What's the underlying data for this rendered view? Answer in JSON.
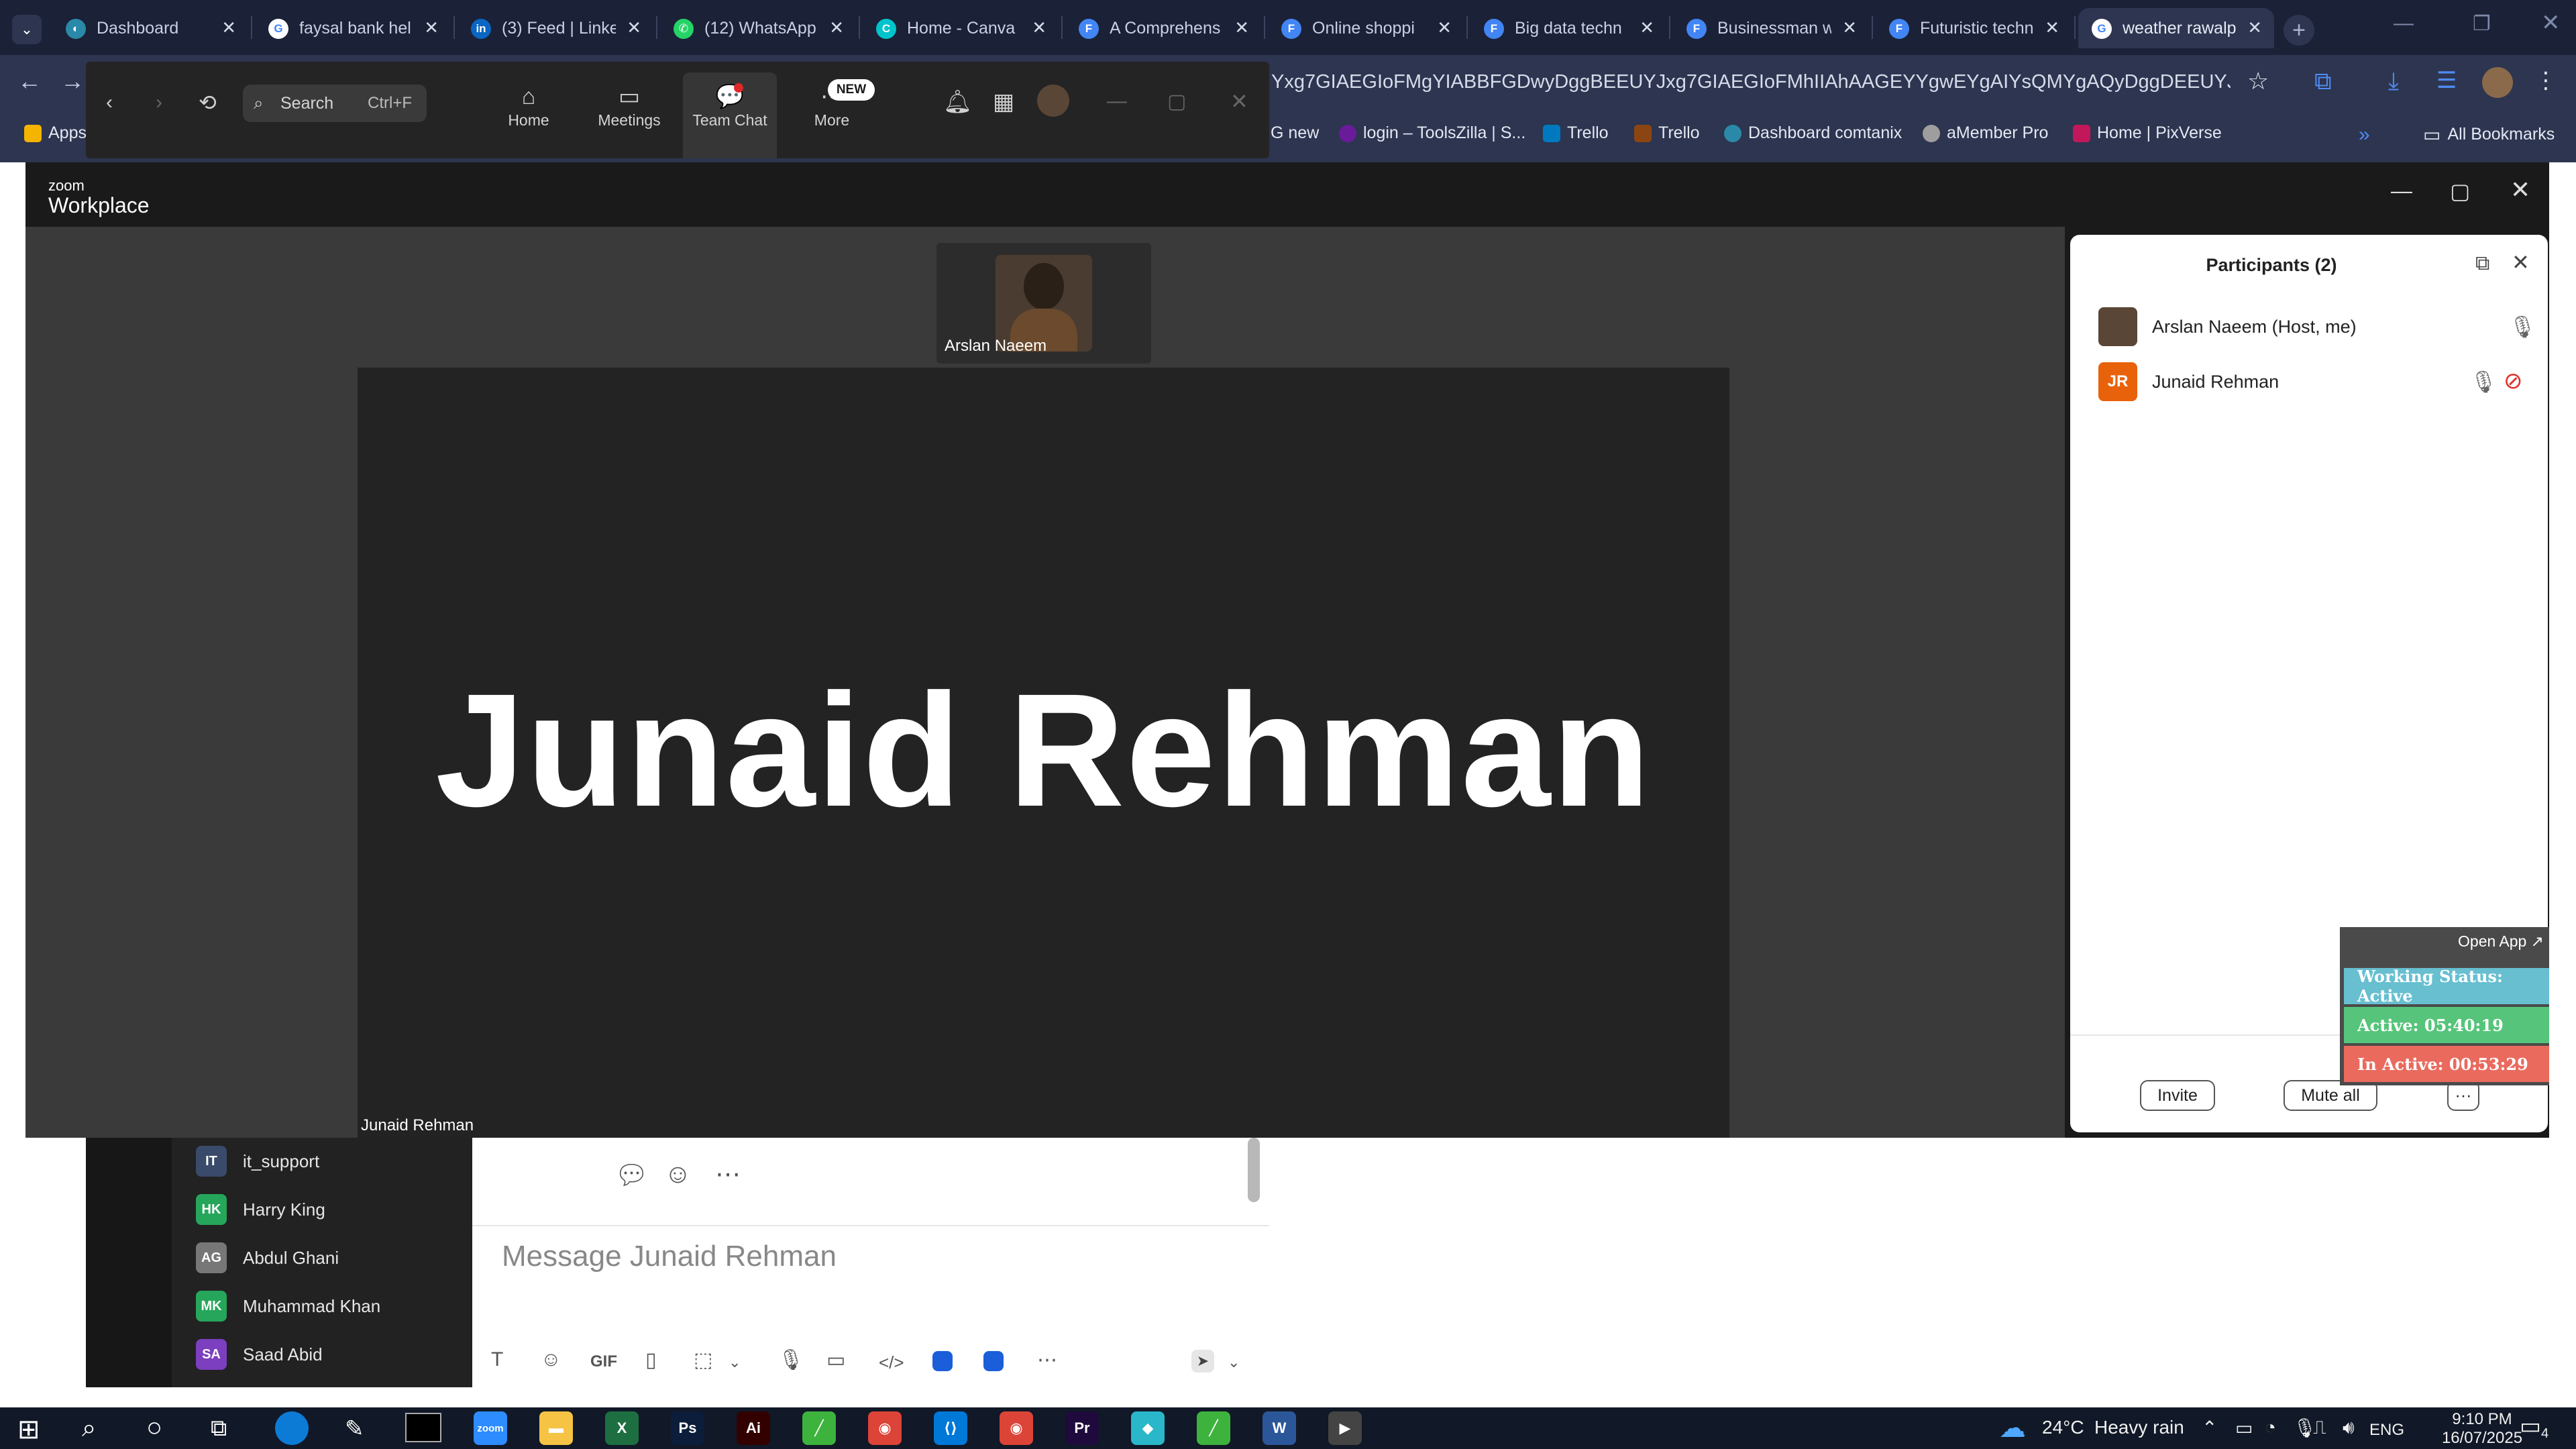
{
  "browser": {
    "tabs": [
      {
        "title": "Dashboard",
        "icon": "dashboard-icon",
        "color": "#2a89a8",
        "glyph": "◐"
      },
      {
        "title": "faysal bank hel",
        "icon": "google-icon",
        "color": "#ffffff",
        "glyph": "G"
      },
      {
        "title": "(3) Feed | Linke",
        "icon": "linkedin-icon",
        "color": "#0a66c2",
        "glyph": "in"
      },
      {
        "title": "(12) WhatsApp",
        "icon": "whatsapp-icon",
        "color": "#25d366",
        "glyph": "✆"
      },
      {
        "title": "Home - Canva",
        "icon": "canva-icon",
        "color": "#00c4cc",
        "glyph": "C"
      },
      {
        "title": "A Comprehens",
        "icon": "docs-icon",
        "color": "#4285f4",
        "glyph": "F"
      },
      {
        "title": "Online shoppi",
        "icon": "docs-icon",
        "color": "#4285f4",
        "glyph": "F"
      },
      {
        "title": "Big data techn",
        "icon": "docs-icon",
        "color": "#4285f4",
        "glyph": "F"
      },
      {
        "title": "Businessman w",
        "icon": "docs-icon",
        "color": "#4285f4",
        "glyph": "F"
      },
      {
        "title": "Futuristic techn",
        "icon": "docs-icon",
        "color": "#4285f4",
        "glyph": "F"
      },
      {
        "title": "weather rawalp",
        "icon": "google-icon",
        "color": "#ffffff",
        "glyph": "G"
      }
    ],
    "url": "Yxg7GIAEGIoFMgYIABBFGDwyDggBEEUYJxg7GIAEGIoFMhIIAhAAGEYYgwEYgAIYsQMYgAQyDggDEEUYJxg7GIAEGIoF",
    "bookmarks": [
      {
        "label": "Apps",
        "color": "#f4b400"
      },
      {
        "label": "G new",
        "color": "#4285f4"
      },
      {
        "label": "login – ToolsZilla | S...",
        "color": "#6a1b9a"
      },
      {
        "label": "Trello",
        "color": "#0079bf"
      },
      {
        "label": "Trello",
        "color": "#0079bf"
      },
      {
        "label": "Dashboard comtanix",
        "color": "#2a89a8"
      },
      {
        "label": "aMember Pro",
        "color": "#9e9e9e"
      },
      {
        "label": "Home | PixVerse",
        "color": "#c2185b"
      }
    ],
    "all_bookmarks": "All Bookmarks"
  },
  "zoom_home": {
    "search_placeholder": "Search",
    "search_shortcut": "Ctrl+F",
    "nav": [
      {
        "label": "Home",
        "icon": "home-icon"
      },
      {
        "label": "Meetings",
        "icon": "video-icon"
      },
      {
        "label": "Team Chat",
        "icon": "chat-icon"
      },
      {
        "label": "More",
        "icon": "more-icon"
      }
    ],
    "new_badge": "NEW"
  },
  "meeting": {
    "brand_top": "zoom",
    "brand_bottom": "Workplace",
    "speaker_name_large": "Junaid Rehman",
    "speaker_label": "Junaid Rehman",
    "thumbnail_name": "Arslan Naeem"
  },
  "participants": {
    "title": "Participants (2)",
    "list": [
      {
        "name": "Arslan Naeem (Host, me)",
        "initials": "",
        "color": "#5a4636"
      },
      {
        "name": "Junaid Rehman",
        "initials": "JR",
        "color": "#e8620c"
      }
    ],
    "invite": "Invite",
    "mute_all": "Mute all",
    "more": "···"
  },
  "working_status": {
    "open_app": "Open App ↗",
    "status": "Working Status: Active",
    "active": "Active: 05:40:19",
    "inactive": "In Active: 00:53:29",
    "colors": {
      "status": "#67bfd0",
      "active": "#56c47a",
      "inactive": "#ea6a5e"
    }
  },
  "team_chat": {
    "contacts": [
      {
        "name": "it_support",
        "initials": "IT",
        "color": "#3a4a6a"
      },
      {
        "name": "Harry King",
        "initials": "HK",
        "color": "#26a65b"
      },
      {
        "name": "Abdul Ghani",
        "initials": "AG",
        "color": "#777777"
      },
      {
        "name": "Muhammad Khan",
        "initials": "MK",
        "color": "#26a65b"
      },
      {
        "name": "Saad Abid",
        "initials": "SA",
        "color": "#7b3fbf"
      }
    ],
    "message_placeholder": "Message Junaid Rehman",
    "gif_label": "GIF"
  },
  "taskbar": {
    "weather_temp": "24°C",
    "weather_text": "Heavy rain",
    "lang": "ENG",
    "time": "9:10 PM",
    "date": "16/07/2025",
    "notifications": "4",
    "apps": [
      {
        "name": "zoom-app",
        "color": "#2d8cff",
        "glyph": "zoom"
      },
      {
        "name": "file-explorer",
        "color": "#f6c344",
        "glyph": "▬"
      },
      {
        "name": "excel",
        "color": "#1d6f42",
        "glyph": "X"
      },
      {
        "name": "photoshop",
        "color": "#0b1d3a",
        "glyph": "Ps"
      },
      {
        "name": "illustrator",
        "color": "#330000",
        "glyph": "Ai"
      },
      {
        "name": "green-app",
        "color": "#3db33d",
        "glyph": "╱"
      },
      {
        "name": "chrome",
        "color": "#db4437",
        "glyph": "◉"
      },
      {
        "name": "vscode",
        "color": "#0078d7",
        "glyph": "⟨⟩"
      },
      {
        "name": "chrome-2",
        "color": "#db4437",
        "glyph": "◉"
      },
      {
        "name": "premiere",
        "color": "#1e0a3c",
        "glyph": "Pr"
      },
      {
        "name": "app-diamond",
        "color": "#2ab7c9",
        "glyph": "◆"
      },
      {
        "name": "green-app-2",
        "color": "#3db33d",
        "glyph": "╱"
      },
      {
        "name": "word",
        "color": "#2b579a",
        "glyph": "W"
      },
      {
        "name": "media-player",
        "color": "#444444",
        "glyph": "▶"
      }
    ]
  }
}
